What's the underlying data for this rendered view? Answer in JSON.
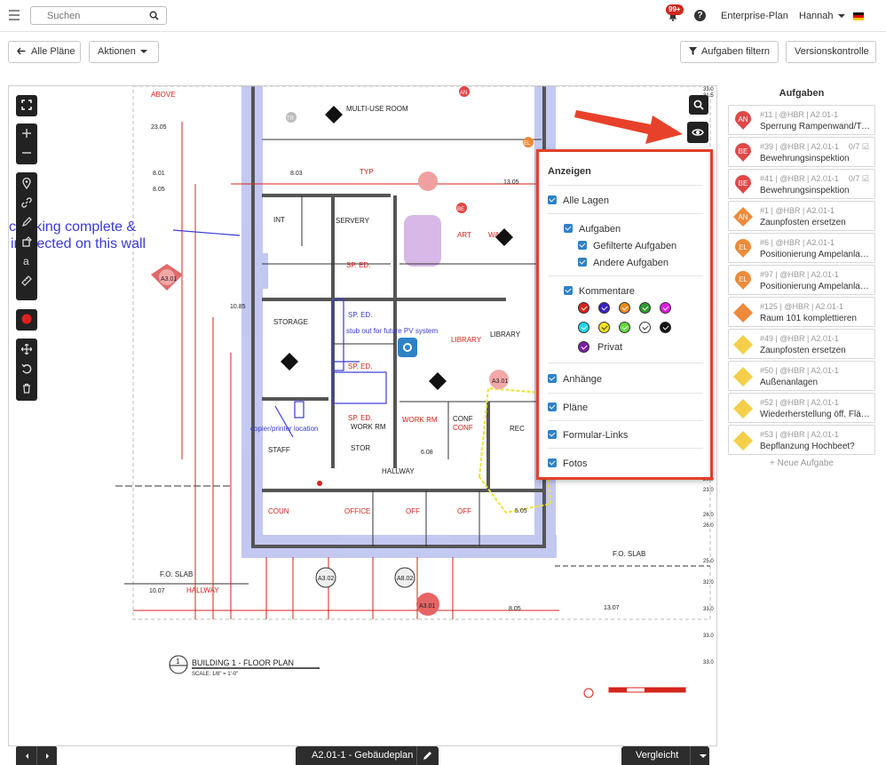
{
  "topbar": {
    "search_placeholder": "Suchen",
    "notifications_badge": "99+",
    "help_label": "?",
    "plan_label": "Enterprise-Plan",
    "user_name": "Hannah"
  },
  "toolbar": {
    "back_label": "Alle Pläne",
    "actions_label": "Aktionen",
    "filter_label": "Aufgaben filtern",
    "version_label": "Versionskontrolle"
  },
  "plan": {
    "sheet_title": "BUILDING 1 - FLOOR PLAN",
    "sheet_scale": "SCALE: 1/8\" = 1'-0\"",
    "sheet_number": "1",
    "markup_text_1": "caulking complete &",
    "markup_text_2": "inspected on this wall",
    "markup_pv": "stub out for future PV system",
    "markup_copier": "copier/printer location",
    "rooms": {
      "multi_use": "MULTI-USE ROOM",
      "servery": "SERVERY",
      "int": "INT",
      "art": "ART",
      "wart": "WART",
      "storage": "STORAGE",
      "sp_ed_1": "SP. ED.",
      "sp_ed_2": "SP. ED.",
      "sp_ed_3": "SP. ED.",
      "library": "LIBRARY",
      "library_2": "LIBRARY",
      "staff": "STAFF",
      "work_rm": "WORK RM",
      "work_rm_2": "WORK RM",
      "conf": "CONF",
      "conf_2": "CONF",
      "rec": "REC",
      "hallway": "HALLWAY",
      "hallway_2": "HALLWAY",
      "coun": "COUN",
      "office": "OFFICE",
      "off_1": "OFF",
      "off_2": "OFF",
      "stor": "STOR",
      "fo_slab": "F.O. SLAB",
      "fo_slab_2": "F.O. SLAB",
      "typ": "TYP",
      "above": "ABOVE"
    },
    "dims": {
      "d1": "23.05",
      "d2": "8.01",
      "d3": "8.05",
      "d4": "8.03",
      "d5": "13.05",
      "d6": "10.85",
      "d7": "10.07",
      "d8": "8.05",
      "d9": "13.07",
      "d10": "5.05",
      "d11": "6.08"
    },
    "tags": {
      "tag_a301": "A3.01",
      "tag_a302": "A3.02",
      "tag_a802": "A8.02",
      "tag_a301_b": "A3.01",
      "tag_a301_c": "A3.01"
    },
    "pins": {
      "an": "AN",
      "be": "BE",
      "el": "EL",
      "tr": "TR"
    }
  },
  "layers": {
    "title": "Anzeigen",
    "all_layers": "Alle Lagen",
    "tasks": "Aufgaben",
    "filtered_tasks": "Gefilterte Aufgaben",
    "other_tasks": "Andere Aufgaben",
    "comments": "Kommentare",
    "private": "Privat",
    "attachments": "Anhänge",
    "plans": "Pläne",
    "form_links": "Formular-Links",
    "photos": "Fotos",
    "comment_colors": [
      "#d4251c",
      "#3a22c9",
      "#ee8a16",
      "#2e9a2e",
      "#e11be0",
      "#1fd6ea",
      "#f2e31b",
      "#63d93b",
      "#ffffff",
      "#111111"
    ],
    "private_color": "#7b1fa2"
  },
  "tasks_panel": {
    "title": "Aufgaben",
    "new_task": "+ Neue Aufgabe",
    "items": [
      {
        "initials": "AN",
        "shape": "pin",
        "color": "#e04848",
        "meta": "#11 | @HBR | A2.01-1",
        "name": "Sperrung Rampenwand/T-S...",
        "count": ""
      },
      {
        "initials": "BE",
        "shape": "pin",
        "color": "#e04848",
        "meta": "#39 | @HBR | A2.01-1",
        "name": "Bewehrungsinspektion",
        "count": "0/7"
      },
      {
        "initials": "BE",
        "shape": "pin",
        "color": "#e04848",
        "meta": "#41 | @HBR | A2.01-1",
        "name": "Bewehrungsinspektion",
        "count": "0/7"
      },
      {
        "initials": "AN",
        "shape": "diamond",
        "color": "#ee8a3a",
        "meta": "#1 | @HBR | A2.01-1",
        "name": "Zaunpfosten ersetzen",
        "count": ""
      },
      {
        "initials": "EL",
        "shape": "pin",
        "color": "#ee8a3a",
        "meta": "#6 | @HBR | A2.01-1",
        "name": "Positionierung Ampelanlag...",
        "count": ""
      },
      {
        "initials": "EL",
        "shape": "pin",
        "color": "#ee8a3a",
        "meta": "#97 | @HBR | A2.01-1",
        "name": "Positionierung Ampelanlag...",
        "count": ""
      },
      {
        "initials": "",
        "shape": "diamond",
        "color": "#ee8a3a",
        "meta": "#125 | @HBR | A2.01-1",
        "name": "Raum 101 komplettieren",
        "count": ""
      },
      {
        "initials": "",
        "shape": "diamond",
        "color": "#f5cf4a",
        "meta": "#49 | @HBR | A2.01-1",
        "name": "Zaunpfosten ersetzen",
        "count": ""
      },
      {
        "initials": "",
        "shape": "diamond",
        "color": "#f5cf4a",
        "meta": "#50 | @HBR | A2.01-1",
        "name": "Außenanlagen",
        "count": ""
      },
      {
        "initials": "",
        "shape": "diamond",
        "color": "#f5cf4a",
        "meta": "#52 | @HBR | A2.01-1",
        "name": "Wiederherstellung öff. Fläc...",
        "count": ""
      },
      {
        "initials": "",
        "shape": "diamond",
        "color": "#f5cf4a",
        "meta": "#53 | @HBR | A2.01-1",
        "name": "Bepflanzung Hochbeet?",
        "count": ""
      }
    ]
  },
  "bottombar": {
    "sheet_label": "A2.01-1 - Gebäudeplan",
    "compare_label": "Vergleicht"
  }
}
